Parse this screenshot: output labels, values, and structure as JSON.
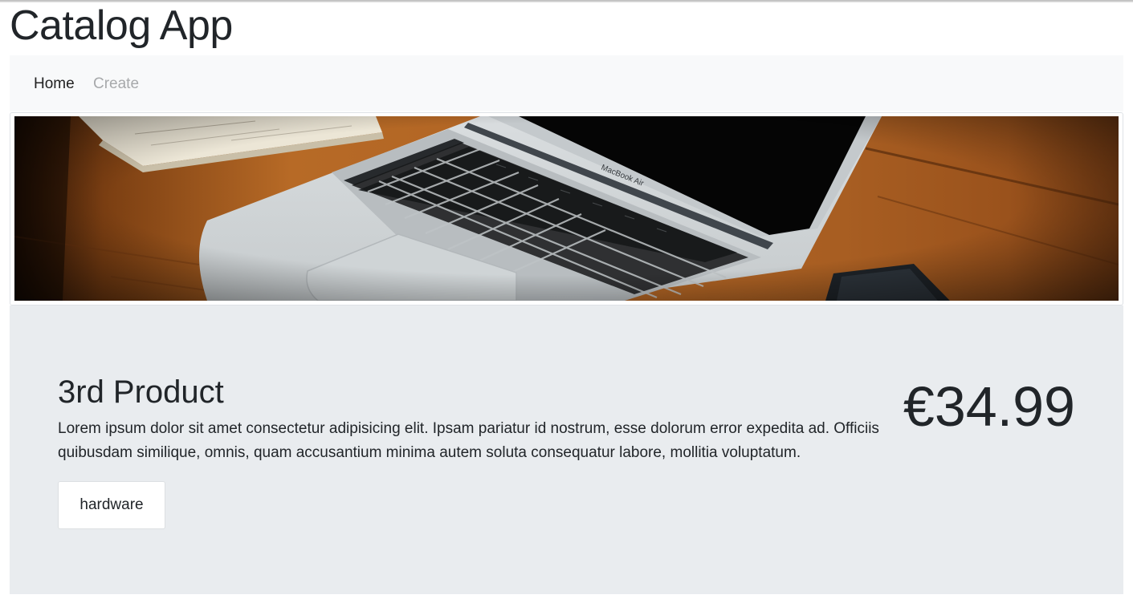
{
  "app": {
    "title": "Catalog App"
  },
  "nav": {
    "items": [
      {
        "label": "Home"
      },
      {
        "label": "Create"
      }
    ]
  },
  "banner": {
    "image_desc": "laptop-on-wooden-desk",
    "laptop_brand_text": "MacBook Air"
  },
  "product": {
    "title": "3rd Product",
    "description": "Lorem ipsum dolor sit amet consectetur adipisicing elit. Ipsam pariatur id nostrum, esse dolorum error expedita ad. Officiis quibusdam similique, omnis, quam accusantium minima autem soluta consequatur labore, mollitia voluptatum.",
    "price": "€34.99",
    "tags": [
      "hardware"
    ]
  },
  "colors": {
    "navbar_bg": "#f8f9fa",
    "jumbotron_bg": "#e9ecef",
    "text": "#212529",
    "nav_inactive": "#a7a9ab"
  }
}
